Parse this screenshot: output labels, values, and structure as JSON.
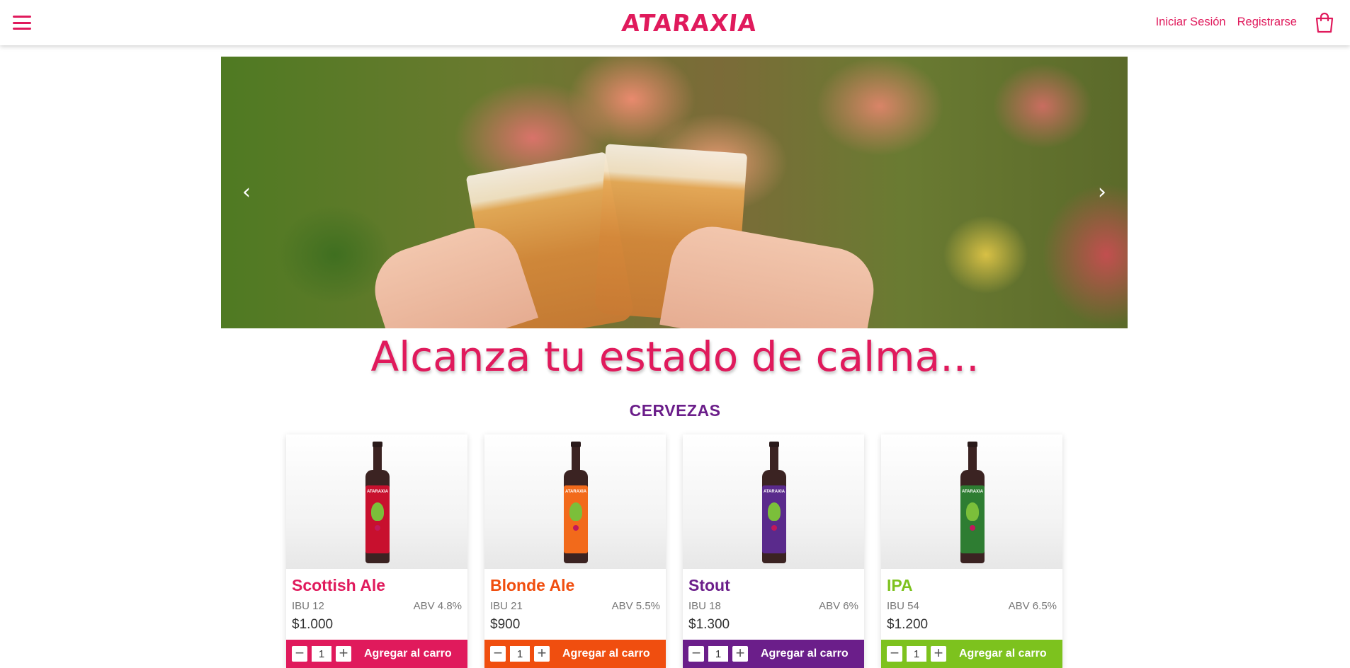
{
  "header": {
    "brand": "ATARAXIA",
    "login_label": "Iniciar Sesión",
    "register_label": "Registrarse",
    "accent_color": "#e01a5c"
  },
  "carousel": {
    "prev_icon": "chevron-left-icon",
    "next_icon": "chevron-right-icon"
  },
  "tagline": "Alcanza tu estado de calma...",
  "section_title": "CERVEZAS",
  "products": [
    {
      "name": "Scottish Ale",
      "ibu": "IBU 12",
      "abv": "ABV 4.8%",
      "price": "$1.000",
      "quantity": "1",
      "cta": "Agregar al carro",
      "color": "#e01a5c",
      "label_color": "#c8102e"
    },
    {
      "name": "Blonde Ale",
      "ibu": "IBU 21",
      "abv": "ABV 5.5%",
      "price": "$900",
      "quantity": "1",
      "cta": "Agregar al carro",
      "color": "#f04e0f",
      "label_color": "#f26a1b"
    },
    {
      "name": "Stout",
      "ibu": "IBU 18",
      "abv": "ABV 6%",
      "price": "$1.300",
      "quantity": "1",
      "cta": "Agregar al carro",
      "color": "#6b1e8a",
      "label_color": "#5a2a8c"
    },
    {
      "name": "IPA",
      "ibu": "IBU 54",
      "abv": "ABV 6.5%",
      "price": "$1.200",
      "quantity": "1",
      "cta": "Agregar al carro",
      "color": "#7dc21e",
      "label_color": "#2e7d32"
    }
  ]
}
